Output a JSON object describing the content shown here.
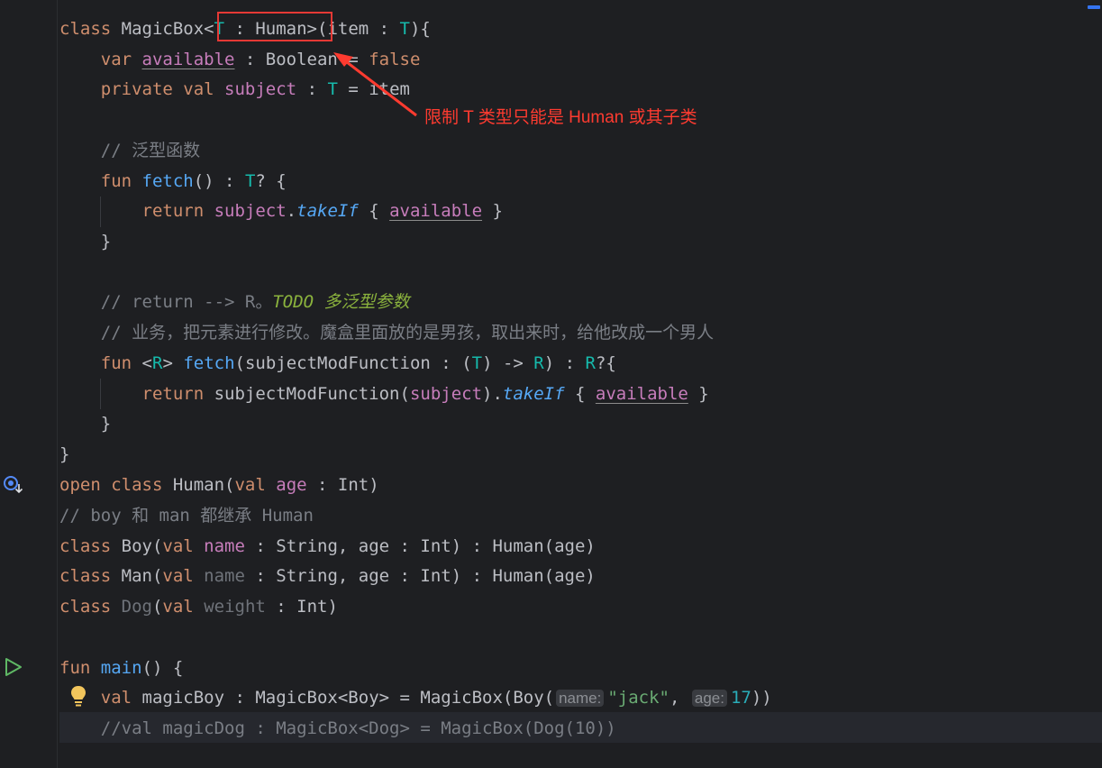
{
  "code_lines": [
    [
      [
        "class ",
        "kw"
      ],
      [
        "MagicBox<",
        ""
      ],
      [
        "T",
        "tp"
      ],
      [
        " : Human>",
        ""
      ],
      [
        "(item : ",
        ""
      ],
      [
        "T",
        "tp"
      ],
      [
        "){",
        ""
      ]
    ],
    [
      [
        "    ",
        ""
      ],
      [
        "var ",
        "kw"
      ],
      [
        "available",
        "prop ul"
      ],
      [
        " : Boolean = ",
        ""
      ],
      [
        "false",
        "kw"
      ]
    ],
    [
      [
        "    ",
        ""
      ],
      [
        "private val ",
        "kw"
      ],
      [
        "subject",
        "prop"
      ],
      [
        " : ",
        ""
      ],
      [
        "T",
        "tp"
      ],
      [
        " = item",
        ""
      ]
    ],
    [],
    [
      [
        "    ",
        ""
      ],
      [
        "// 泛型函数",
        "cmt"
      ]
    ],
    [
      [
        "    ",
        ""
      ],
      [
        "fun ",
        "kw"
      ],
      [
        "fetch",
        "fn"
      ],
      [
        "() : ",
        ""
      ],
      [
        "T",
        "tp"
      ],
      [
        "? {",
        ""
      ]
    ],
    [
      [
        "        ",
        ""
      ],
      [
        "return ",
        "kw"
      ],
      [
        "subject",
        "prop"
      ],
      [
        ".",
        ""
      ],
      [
        "takeIf",
        "ital"
      ],
      [
        " { ",
        ""
      ],
      [
        "available",
        "prop ul"
      ],
      [
        " }",
        ""
      ]
    ],
    [
      [
        "    }",
        ""
      ]
    ],
    [],
    [
      [
        "    ",
        ""
      ],
      [
        "// return --> R。",
        "cmt"
      ],
      [
        "TODO 多泛型参数",
        "todo"
      ]
    ],
    [
      [
        "    ",
        ""
      ],
      [
        "// 业务，把元素进行修改。魔盒里面放的是男孩，取出来时，给他改成一个男人",
        "cmt"
      ]
    ],
    [
      [
        "    ",
        ""
      ],
      [
        "fun ",
        "kw"
      ],
      [
        "<",
        ""
      ],
      [
        "R",
        "tp"
      ],
      [
        "> ",
        ""
      ],
      [
        "fetch",
        "fn"
      ],
      [
        "(subjectModFunction : (",
        ""
      ],
      [
        "T",
        "tp"
      ],
      [
        ") -> ",
        ""
      ],
      [
        "R",
        "tp"
      ],
      [
        ") : ",
        ""
      ],
      [
        "R",
        "tp"
      ],
      [
        "?{",
        ""
      ]
    ],
    [
      [
        "        ",
        ""
      ],
      [
        "return ",
        "kw"
      ],
      [
        "subjectModFunction(",
        ""
      ],
      [
        "subject",
        "prop"
      ],
      [
        ").",
        ""
      ],
      [
        "takeIf",
        "ital"
      ],
      [
        " { ",
        ""
      ],
      [
        "available",
        "prop ul"
      ],
      [
        " }",
        ""
      ]
    ],
    [
      [
        "    }",
        ""
      ]
    ],
    [
      [
        "}",
        ""
      ]
    ],
    [
      [
        "open class ",
        "kw"
      ],
      [
        "Human(",
        ""
      ],
      [
        "val ",
        "kw"
      ],
      [
        "age",
        "prop"
      ],
      [
        " : Int)",
        ""
      ]
    ],
    [
      [
        "// boy 和 man 都继承 Human",
        "cmt"
      ]
    ],
    [
      [
        "class ",
        "kw"
      ],
      [
        "Boy(",
        ""
      ],
      [
        "val ",
        "kw"
      ],
      [
        "name",
        "prop"
      ],
      [
        " : String, age : Int) : Human(age)",
        ""
      ]
    ],
    [
      [
        "class ",
        "kw"
      ],
      [
        "Man(",
        ""
      ],
      [
        "val ",
        "kw"
      ],
      [
        "name",
        "dim"
      ],
      [
        " : String, age : Int) : Human(age)",
        ""
      ]
    ],
    [
      [
        "class ",
        "kw"
      ],
      [
        "Dog",
        "dim"
      ],
      [
        "(",
        ""
      ],
      [
        "val ",
        "kw"
      ],
      [
        "weight",
        "dim"
      ],
      [
        " : Int)",
        ""
      ]
    ],
    [],
    [
      [
        "fun ",
        "kw"
      ],
      [
        "main",
        "fn"
      ],
      [
        "() {",
        ""
      ]
    ],
    [
      [
        "    ",
        ""
      ],
      [
        "val ",
        "kw"
      ],
      [
        "magicBoy : MagicBox<Boy> = MagicBox(Boy(",
        ""
      ],
      [
        "name:",
        "hint"
      ],
      [
        "\"jack\"",
        "str"
      ],
      [
        ", ",
        ""
      ],
      [
        "age:",
        "hint"
      ],
      [
        "17",
        "num"
      ],
      [
        "))",
        ""
      ]
    ],
    [
      [
        "    //val magicDog : MagicBox<Dog> = MagicBox(Dog(10))",
        "cmt"
      ]
    ]
  ],
  "annotation": "限制 T 类型只能是 Human 或其子类",
  "gutter_icons": [
    "implemented-icon",
    "run-icon",
    "lightbulb-icon"
  ],
  "colors": {
    "keyword": "#cf8e6d",
    "type_param": "#16baac",
    "function": "#56a8f5",
    "property": "#c77dbb",
    "string": "#6aab73",
    "number": "#2aacb8",
    "comment": "#7a7e85",
    "todo": "#8bb33d",
    "annotation": "#ff3b30"
  }
}
